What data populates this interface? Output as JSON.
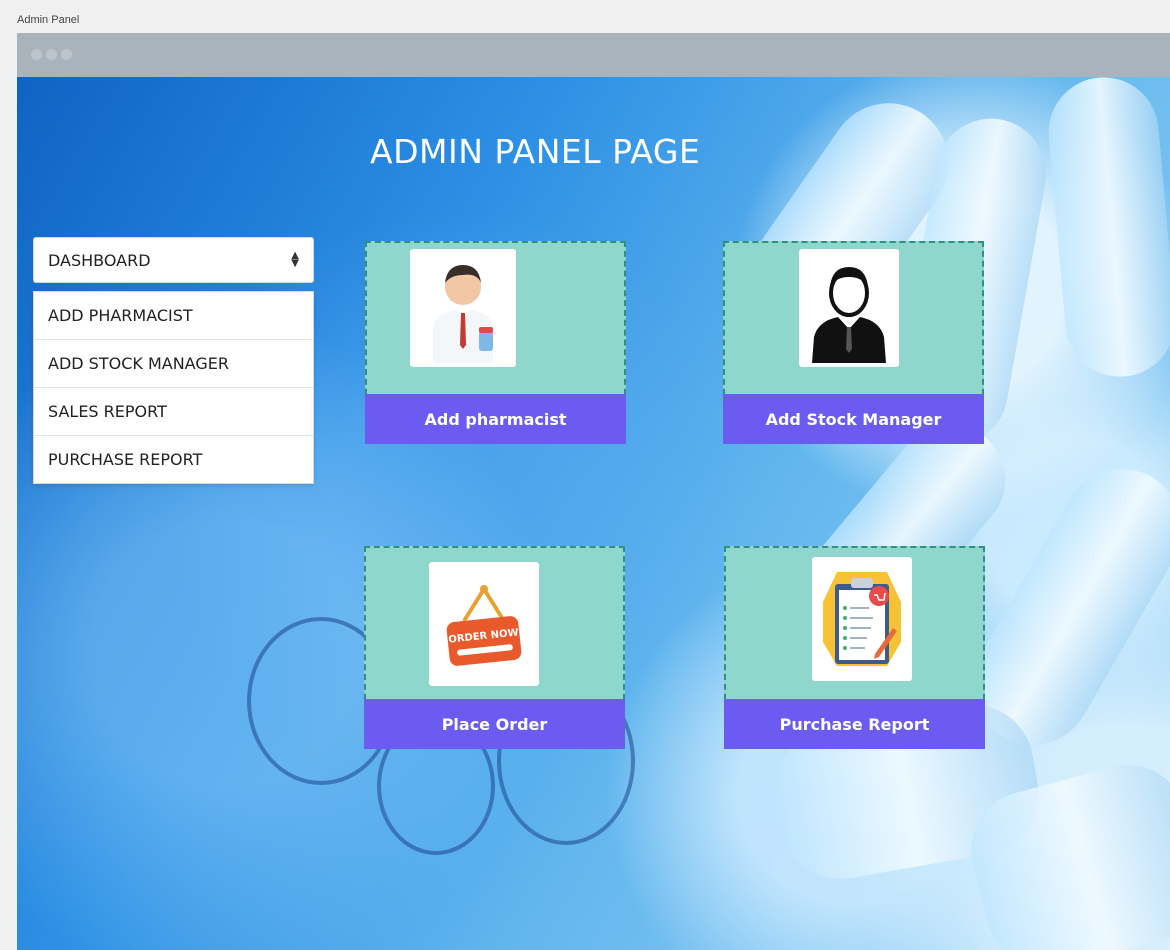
{
  "window": {
    "caption": "Admin Panel"
  },
  "page": {
    "title": "ADMIN PANEL PAGE"
  },
  "menu": {
    "selected": "DASHBOARD",
    "items": [
      {
        "label": "ADD PHARMACIST"
      },
      {
        "label": "ADD STOCK MANAGER"
      },
      {
        "label": "SALES REPORT"
      },
      {
        "label": "PURCHASE REPORT"
      }
    ]
  },
  "cards": [
    {
      "label": "Add pharmacist",
      "icon": "pharmacist-icon"
    },
    {
      "label": "Add Stock Manager",
      "icon": "manager-icon"
    },
    {
      "label": "Place Order",
      "icon": "order-now-sign-icon",
      "sign_text": "ORDER NOW"
    },
    {
      "label": "Purchase Report",
      "icon": "clipboard-report-icon"
    }
  ],
  "colors": {
    "card_bg": "#8fd6cc",
    "card_button": "#6b5bf0",
    "titlebar": "#a9b3bb"
  }
}
